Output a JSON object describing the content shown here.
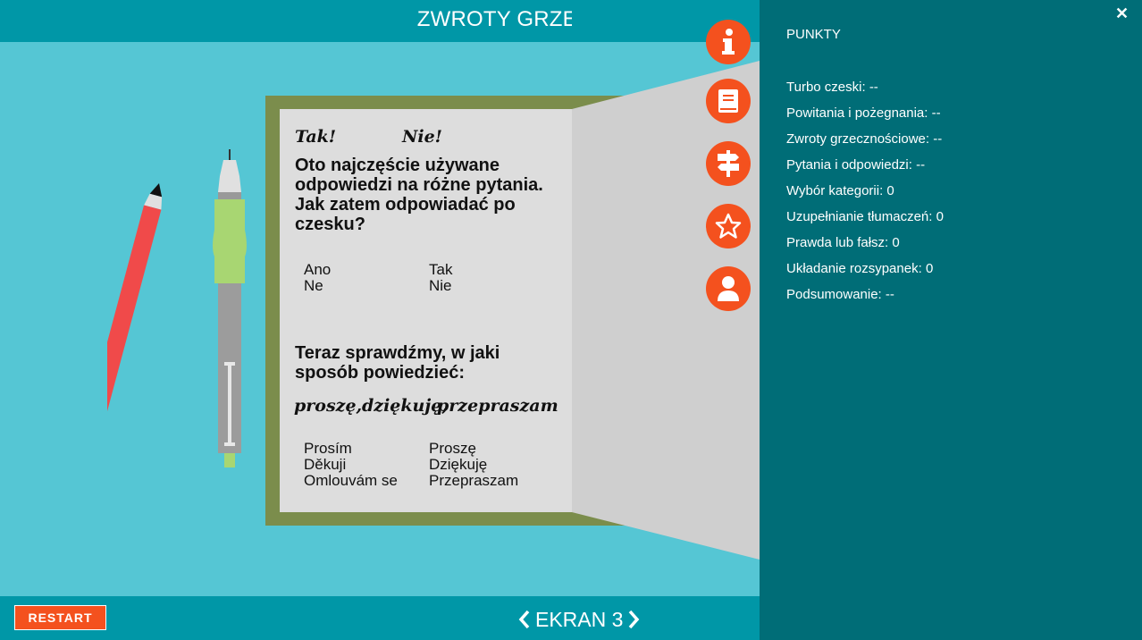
{
  "header": {
    "title": "ZWROTY GRZECZNOŚCIOWE"
  },
  "notebook": {
    "title_yes": "Tak!",
    "title_no": "Nie!",
    "intro": [
      "Oto najczęście używane",
      "odpowiedzi na różne pytania.",
      "Jak zatem odpowiadać po",
      "czesku?"
    ],
    "pairs1": {
      "czech": [
        "Ano",
        "Ne"
      ],
      "polish": [
        "Tak",
        "Nie"
      ]
    },
    "question2": [
      "Teraz sprawdźmy, w jaki",
      "sposób powiedzieć:"
    ],
    "phrases": [
      "proszę,",
      "dziękuję,",
      "przepraszam"
    ],
    "pairs2": {
      "czech": [
        "Prosím",
        "Děkuji",
        "Omlouvám se"
      ],
      "polish": [
        "Proszę",
        "Dziękuję",
        "Przepraszam"
      ]
    }
  },
  "side_buttons": [
    {
      "icon": "info-icon"
    },
    {
      "icon": "book-icon"
    },
    {
      "icon": "signpost-icon"
    },
    {
      "icon": "star-icon"
    },
    {
      "icon": "user-icon"
    }
  ],
  "footer": {
    "restart_label": "RESTART",
    "screen_label": "EKRAN 3"
  },
  "panel": {
    "title": "PUNKTY",
    "close_icon": "close-icon",
    "scores": [
      {
        "label": "Turbo czeski:",
        "value": "--"
      },
      {
        "label": "Powitania i pożegnania:",
        "value": "--"
      },
      {
        "label": "Zwroty grzecznościowe:",
        "value": "--"
      },
      {
        "label": "Pytania i odpowiedzi:",
        "value": "--"
      },
      {
        "label": "Wybór kategorii:",
        "value": "0"
      },
      {
        "label": "Uzupełnianie tłumaczeń:",
        "value": "0"
      },
      {
        "label": "Prawda lub fałsz:",
        "value": "0"
      },
      {
        "label": "Układanie rozsypanek:",
        "value": "0"
      },
      {
        "label": "Podsumowanie:",
        "value": "--"
      }
    ]
  },
  "colors": {
    "accent": "#f4511e",
    "header": "#0097a7",
    "panel": "#006d77",
    "stage": "#55c6d4"
  }
}
